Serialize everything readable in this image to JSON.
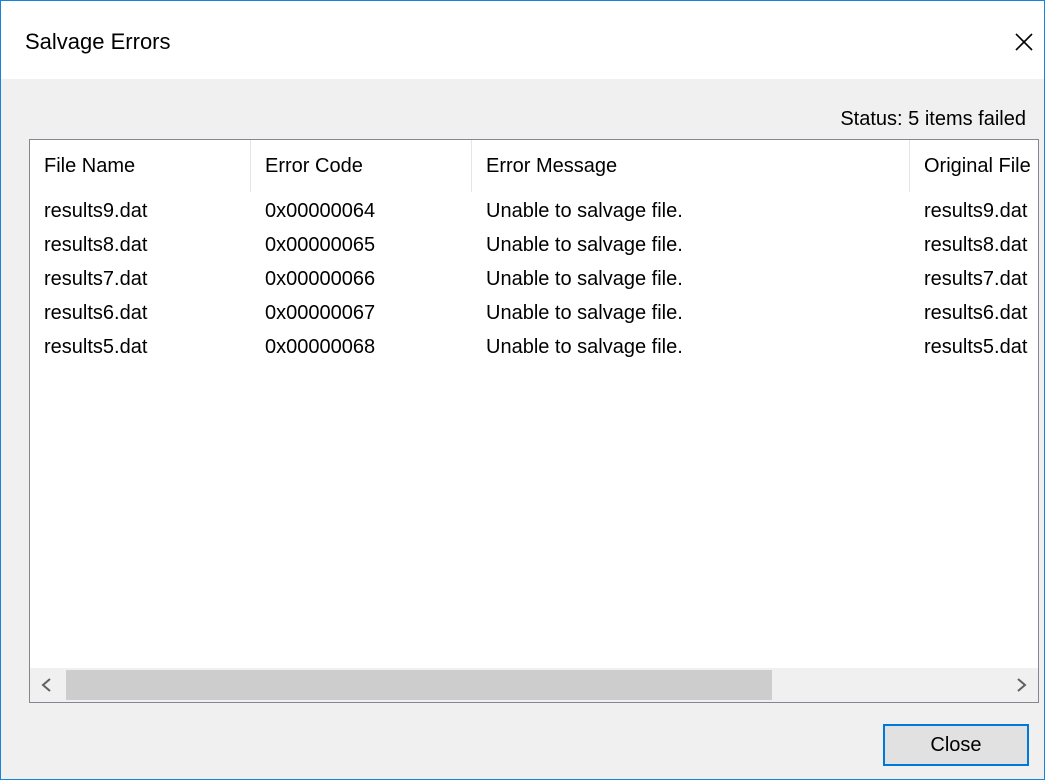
{
  "window": {
    "title": "Salvage Errors",
    "accent_color": "#1883d7"
  },
  "status_text": "Status: 5 items failed",
  "list": {
    "columns": [
      "File Name",
      "Error Code",
      "Error Message",
      "Original File"
    ],
    "rows": [
      [
        "results9.dat",
        "0x00000064",
        "Unable to salvage file.",
        "results9.dat"
      ],
      [
        "results8.dat",
        "0x00000065",
        "Unable to salvage file.",
        "results8.dat"
      ],
      [
        "results7.dat",
        "0x00000066",
        "Unable to salvage file.",
        "results7.dat"
      ],
      [
        "results6.dat",
        "0x00000067",
        "Unable to salvage file.",
        "results6.dat"
      ],
      [
        "results5.dat",
        "0x00000068",
        "Unable to salvage file.",
        "results5.dat"
      ]
    ]
  },
  "scrollbar": {
    "left_icon": "chevron-left-icon",
    "right_icon": "chevron-right-icon"
  },
  "buttons": {
    "close_label": "Close"
  },
  "icons": {
    "close": "close-icon"
  }
}
